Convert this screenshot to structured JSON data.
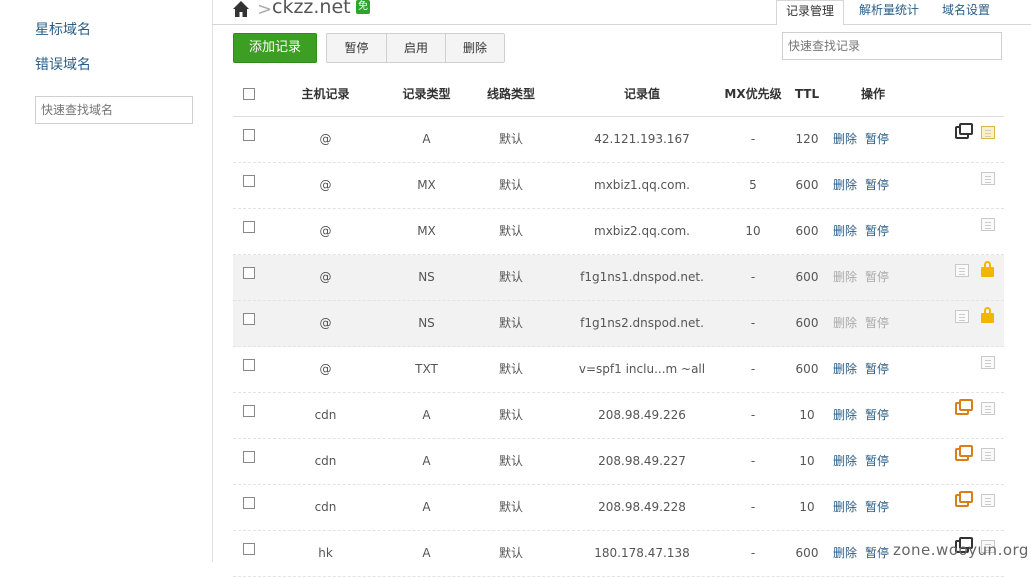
{
  "sidebar": {
    "starred_label": "星标域名",
    "error_label": "错误域名",
    "search_placeholder": "快速查找域名"
  },
  "header": {
    "domain": "ckzz.net",
    "free_badge": "免",
    "tabs": [
      "记录管理",
      "解析量统计",
      "域名设置"
    ],
    "active_tab": 0
  },
  "toolbar": {
    "add_label": "添加记录",
    "pause_label": "暂停",
    "enable_label": "启用",
    "delete_label": "删除",
    "search_placeholder": "快速查找记录"
  },
  "table": {
    "columns": [
      "主机记录",
      "记录类型",
      "线路类型",
      "记录值",
      "MX优先级",
      "TTL",
      "操作"
    ],
    "rows": [
      {
        "host": "@",
        "type": "A",
        "line": "默认",
        "value": "42.121.193.167",
        "mx": "-",
        "ttl": "120",
        "del": "删除",
        "pause": "暂停",
        "locked": false,
        "icons": [
          "chat-icon",
          "note-active-icon"
        ]
      },
      {
        "host": "@",
        "type": "MX",
        "line": "默认",
        "value": "mxbiz1.qq.com.",
        "mx": "5",
        "ttl": "600",
        "del": "删除",
        "pause": "暂停",
        "locked": false,
        "icons": [
          "note-icon"
        ]
      },
      {
        "host": "@",
        "type": "MX",
        "line": "默认",
        "value": "mxbiz2.qq.com.",
        "mx": "10",
        "ttl": "600",
        "del": "删除",
        "pause": "暂停",
        "locked": false,
        "icons": [
          "note-icon"
        ]
      },
      {
        "host": "@",
        "type": "NS",
        "line": "默认",
        "value": "f1g1ns1.dnspod.net.",
        "mx": "-",
        "ttl": "600",
        "del": "删除",
        "pause": "暂停",
        "locked": true,
        "icons": [
          "note-icon",
          "lock-icon"
        ]
      },
      {
        "host": "@",
        "type": "NS",
        "line": "默认",
        "value": "f1g1ns2.dnspod.net.",
        "mx": "-",
        "ttl": "600",
        "del": "删除",
        "pause": "暂停",
        "locked": true,
        "icons": [
          "note-icon",
          "lock-icon"
        ]
      },
      {
        "host": "@",
        "type": "TXT",
        "line": "默认",
        "value": "v=spf1 inclu...m ~all",
        "mx": "-",
        "ttl": "600",
        "del": "删除",
        "pause": "暂停",
        "locked": false,
        "icons": [
          "note-icon"
        ]
      },
      {
        "host": "cdn",
        "type": "A",
        "line": "默认",
        "value": "208.98.49.226",
        "mx": "-",
        "ttl": "10",
        "del": "删除",
        "pause": "暂停",
        "locked": false,
        "icons": [
          "chat-orange-icon",
          "note-icon"
        ]
      },
      {
        "host": "cdn",
        "type": "A",
        "line": "默认",
        "value": "208.98.49.227",
        "mx": "-",
        "ttl": "10",
        "del": "删除",
        "pause": "暂停",
        "locked": false,
        "icons": [
          "chat-orange-icon",
          "note-icon"
        ]
      },
      {
        "host": "cdn",
        "type": "A",
        "line": "默认",
        "value": "208.98.49.228",
        "mx": "-",
        "ttl": "10",
        "del": "删除",
        "pause": "暂停",
        "locked": false,
        "icons": [
          "chat-orange-icon",
          "note-icon"
        ]
      },
      {
        "host": "hk",
        "type": "A",
        "line": "默认",
        "value": "180.178.47.138",
        "mx": "-",
        "ttl": "600",
        "del": "删除",
        "pause": "暂停",
        "locked": false,
        "icons": [
          "chat-icon",
          "note-icon"
        ]
      }
    ]
  },
  "watermark": "zone.wooyun.org"
}
